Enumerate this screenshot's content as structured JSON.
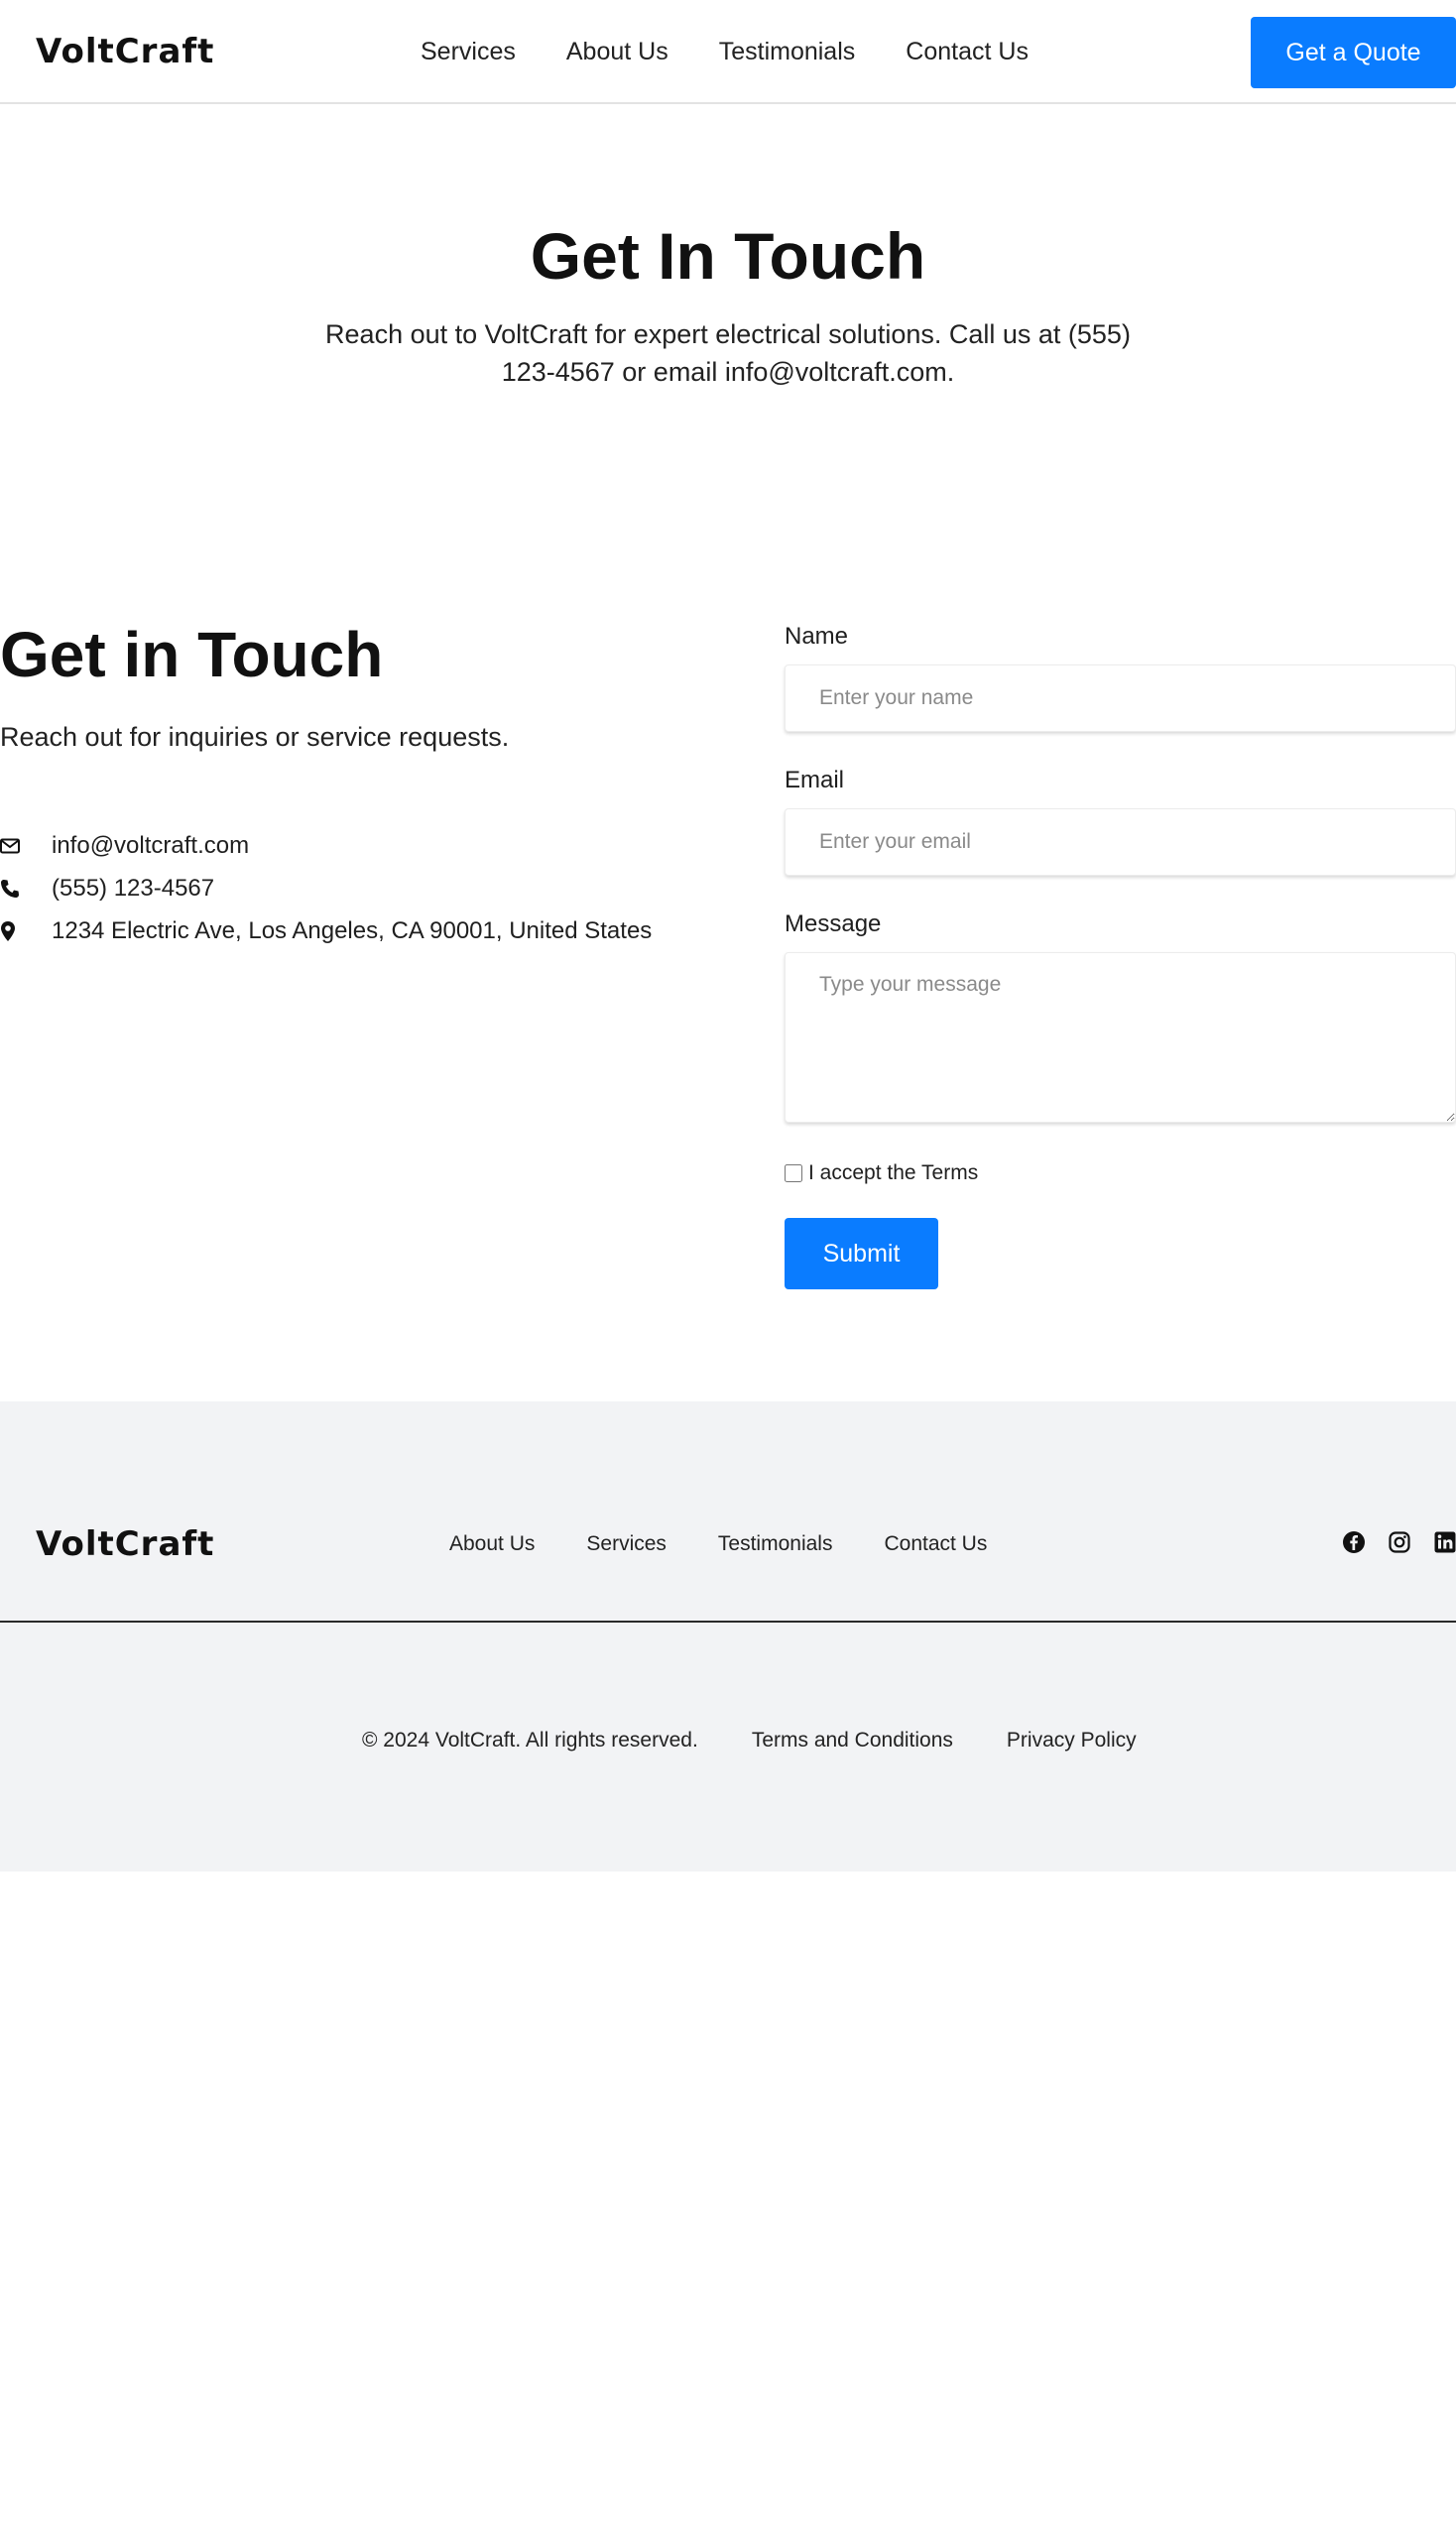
{
  "header": {
    "logo": "VoltCraft",
    "nav": [
      "Services",
      "About Us",
      "Testimonials",
      "Contact Us"
    ],
    "cta_label": "Get a Quote"
  },
  "hero": {
    "title": "Get In Touch",
    "subtitle": "Reach out to VoltCraft for expert electrical solutions. Call us at (555) 123-4567 or email info@voltcraft.com."
  },
  "contact": {
    "title": "Get in Touch",
    "subtitle": "Reach out for inquiries or service requests.",
    "info": [
      {
        "icon": "envelope-icon",
        "text": "info@voltcraft.com"
      },
      {
        "icon": "phone-icon",
        "text": "(555) 123-4567"
      },
      {
        "icon": "map-pin-icon",
        "text": "1234 Electric Ave, Los Angeles, CA 90001, United States"
      }
    ]
  },
  "form": {
    "name_label": "Name",
    "name_placeholder": "Enter your name",
    "email_label": "Email",
    "email_placeholder": "Enter your email",
    "message_label": "Message",
    "message_placeholder": "Type your message",
    "terms_label": "I accept the Terms",
    "submit_label": "Submit"
  },
  "footer": {
    "logo": "VoltCraft",
    "nav": [
      "About Us",
      "Services",
      "Testimonials",
      "Contact Us"
    ],
    "social": [
      "facebook-icon",
      "instagram-icon",
      "linkedin-icon"
    ],
    "copyright": "© 2024 VoltCraft. All rights reserved.",
    "terms": "Terms and Conditions",
    "privacy": "Privacy Policy"
  },
  "colors": {
    "accent": "#0a7cff",
    "footer_bg": "#f2f3f5"
  }
}
